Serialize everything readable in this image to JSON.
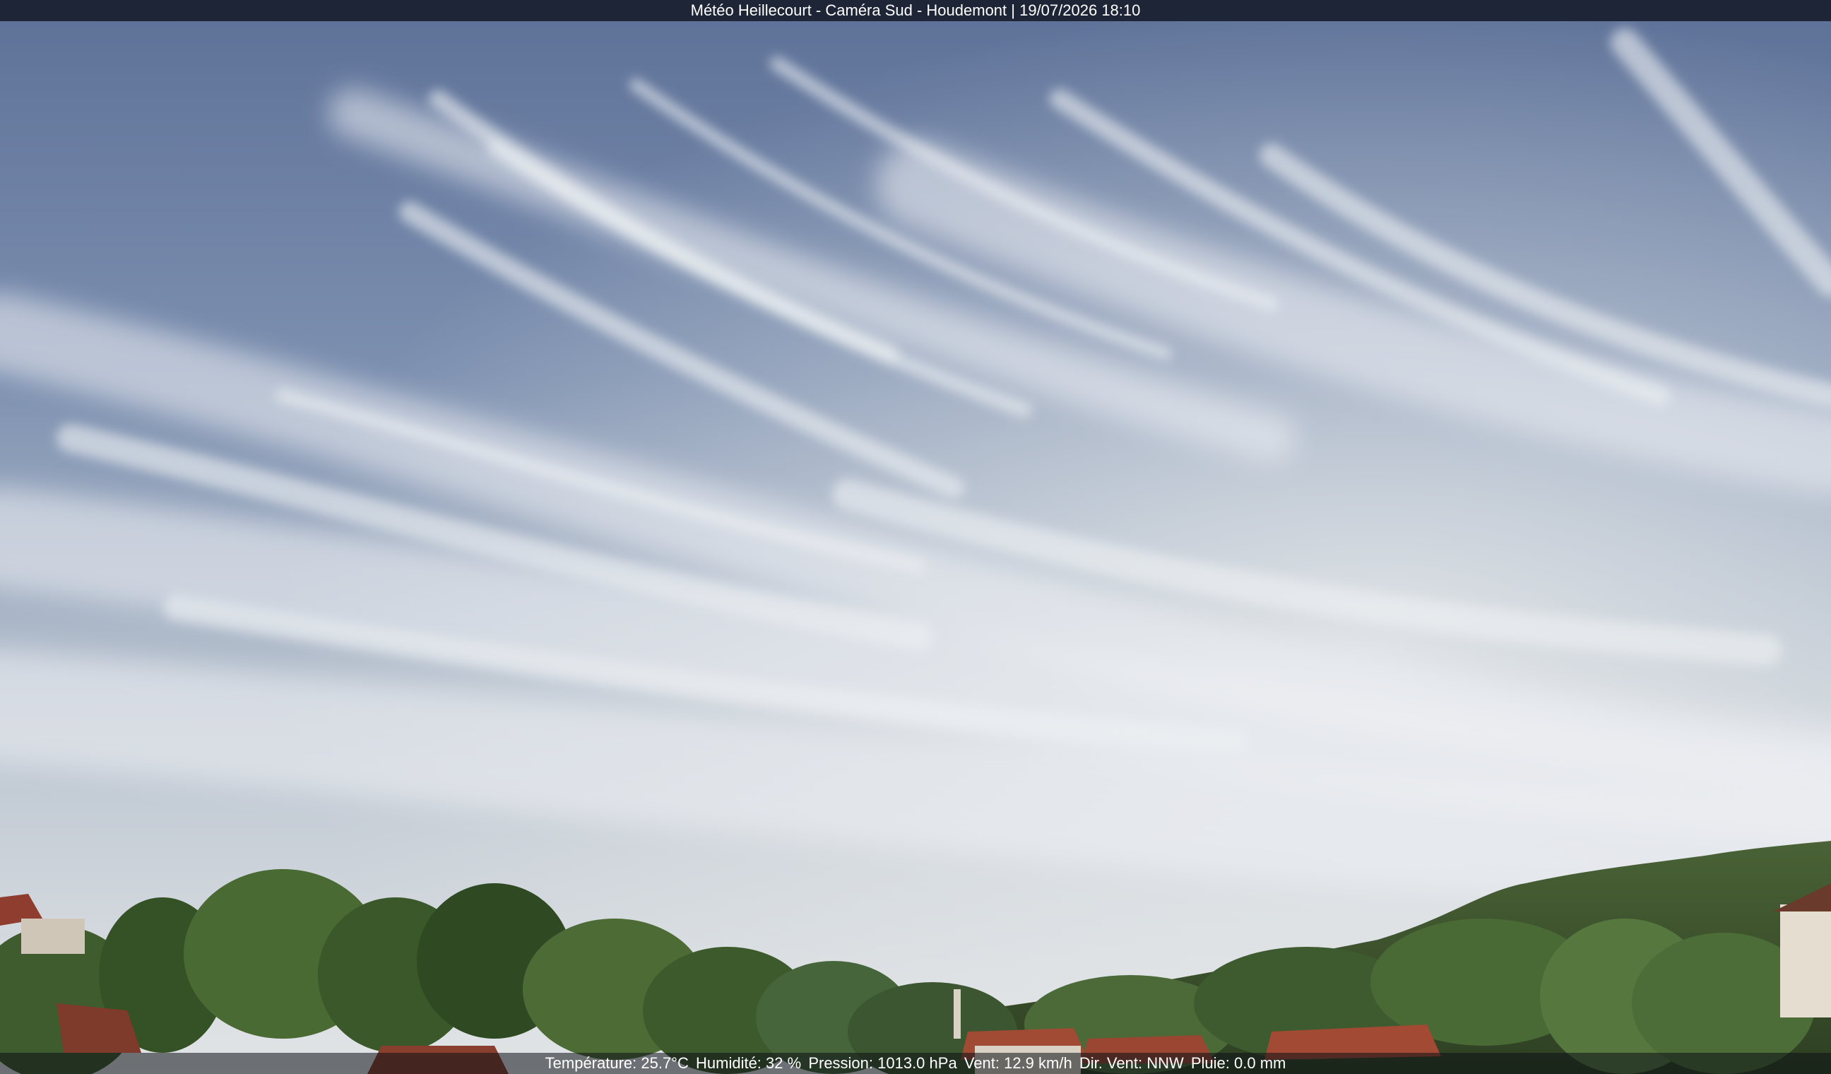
{
  "camera": {
    "station": "Météo Heillecourt",
    "camera_name": "Caméra Sud",
    "location": "Houdemont",
    "datetime": "19/07/2026 18:10",
    "title_text": "Météo Heillecourt - Caméra Sud - Houdemont | 19/07/2026 18:10"
  },
  "weather": {
    "temperature": "Température: 25.7°C",
    "humidity": "Humidité: 32 %",
    "pressure": "Pression: 1013.0 hPa",
    "wind_speed": "Vent: 12.9 km/h",
    "wind_direction": "Dir. Vent: NNW",
    "rain": "Pluie: 0.0 mm"
  },
  "scene": {
    "description_icon": "landscape-photo",
    "sky_top_color": "#5f7398",
    "sky_bottom_color": "#dfe3e6",
    "vegetation_color": "#3f5a2c",
    "roof_color": "#9a4a34"
  }
}
